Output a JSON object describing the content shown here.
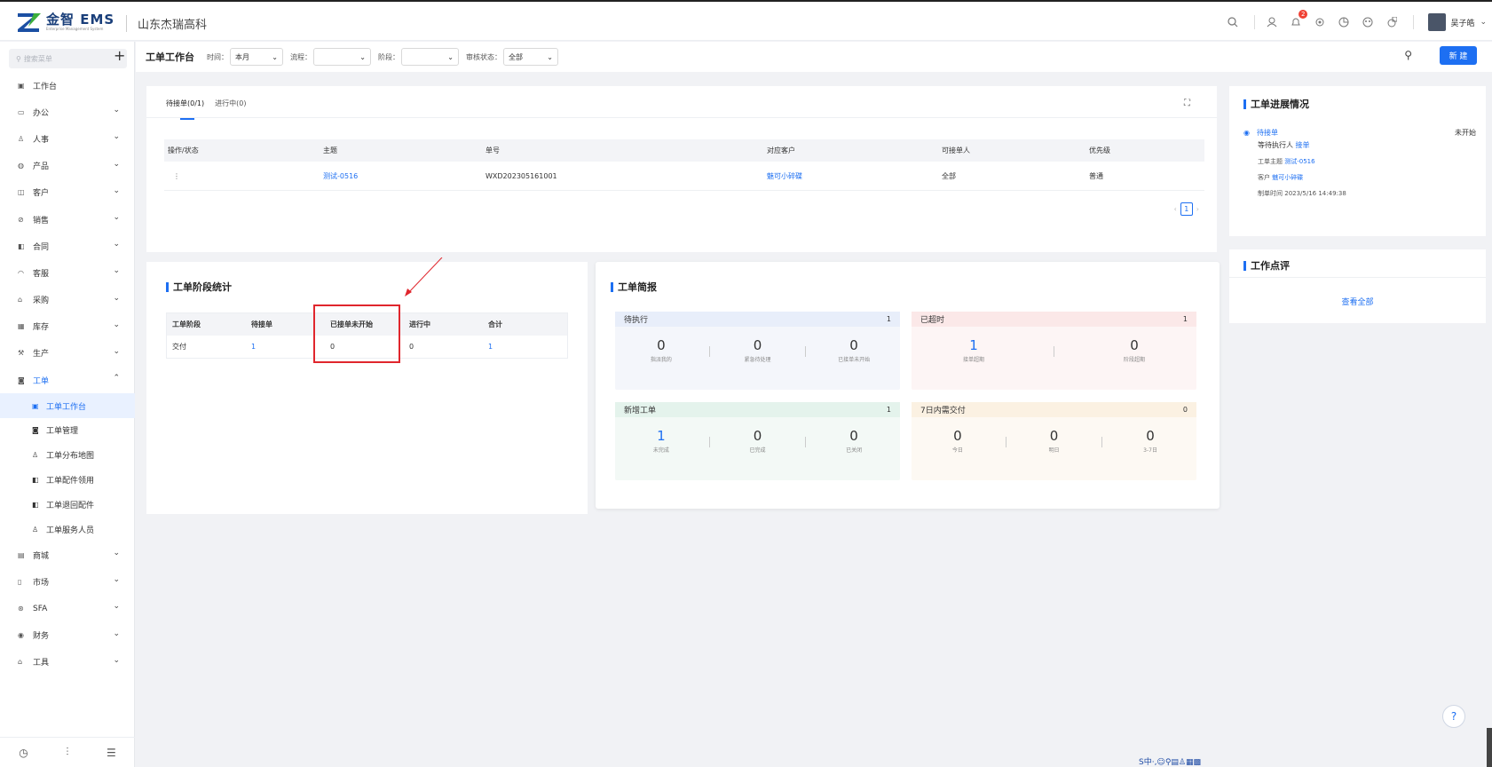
{
  "header": {
    "logo_title": "金智 EMS",
    "logo_sub": "Enterprise Management System",
    "company": "山东杰瑞高科",
    "notif_count": "2",
    "user": "吴子皓"
  },
  "sidebar": {
    "search_placeholder": "搜索菜单",
    "menu": [
      {
        "label": "工作台",
        "icon": "▣"
      },
      {
        "label": "办公",
        "icon": "▭"
      },
      {
        "label": "人事",
        "icon": "♙"
      },
      {
        "label": "产品",
        "icon": "◍"
      },
      {
        "label": "客户",
        "icon": "◫"
      },
      {
        "label": "销售",
        "icon": "⊘"
      },
      {
        "label": "合同",
        "icon": "◧"
      },
      {
        "label": "客服",
        "icon": "◠"
      },
      {
        "label": "采购",
        "icon": "⌂"
      },
      {
        "label": "库存",
        "icon": "▦"
      },
      {
        "label": "生产",
        "icon": "⚒"
      },
      {
        "label": "工单",
        "icon": "◙"
      }
    ],
    "submenu": [
      {
        "label": "工单工作台",
        "icon": "▣"
      },
      {
        "label": "工单管理",
        "icon": "◙"
      },
      {
        "label": "工单分布地图",
        "icon": "♙"
      },
      {
        "label": "工单配件领用",
        "icon": "◧"
      },
      {
        "label": "工单退回配件",
        "icon": "◧"
      },
      {
        "label": "工单服务人员",
        "icon": "♙"
      }
    ],
    "menu2": [
      {
        "label": "商城",
        "icon": "▤"
      },
      {
        "label": "市场",
        "icon": "▯"
      },
      {
        "label": "SFA",
        "icon": "⊛"
      },
      {
        "label": "财务",
        "icon": "◉"
      },
      {
        "label": "工具",
        "icon": "⌂"
      }
    ]
  },
  "filter": {
    "title": "工单工作台",
    "time_label": "时间：",
    "time_value": "本月",
    "process_label": "流程：",
    "process_value": "",
    "stage_label": "阶段：",
    "stage_value": "",
    "audit_label": "审核状态：",
    "audit_value": "全部",
    "new_button": "新 建"
  },
  "orders": {
    "tabs": [
      "待接单(0/1)",
      "进行中(0)"
    ],
    "columns": [
      "操作/状态",
      "主题",
      "单号",
      "对应客户",
      "可接单人",
      "优先级"
    ],
    "rows": [
      {
        "action": "⋮",
        "subject": "测试-0516",
        "number": "WXD202305161001",
        "customer": "魅可小碎碟",
        "assignee": "全部",
        "priority": "普通"
      }
    ],
    "page": "1"
  },
  "stage_stats": {
    "title": "工单阶段统计",
    "columns": [
      "工单阶段",
      "待接单",
      "已接单未开始",
      "进行中",
      "合计"
    ],
    "row": [
      "交付",
      "1",
      "0",
      "0",
      "1"
    ]
  },
  "brief": {
    "title": "工单简报",
    "cards": [
      {
        "title": "待执行",
        "count": "1",
        "bg": "#f4f6fb",
        "hbg": "#e8eefa",
        "items": [
          {
            "v": "0",
            "l": "指派我的"
          },
          {
            "v": "0",
            "l": "紧急待处理"
          },
          {
            "v": "0",
            "l": "已接单未开始"
          }
        ]
      },
      {
        "title": "已超时",
        "count": "1",
        "bg": "#fdf5f5",
        "hbg": "#fbe8e8",
        "items": [
          {
            "v": "1",
            "l": "接单超期"
          },
          {
            "v": "0",
            "l": "阶段超期"
          }
        ]
      },
      {
        "title": "新增工单",
        "count": "1",
        "bg": "#f3f9f6",
        "hbg": "#e4f3ec",
        "items": [
          {
            "v": "1",
            "l": "未完成"
          },
          {
            "v": "0",
            "l": "已完成"
          },
          {
            "v": "0",
            "l": "已关闭"
          }
        ]
      },
      {
        "title": "7日内需交付",
        "count": "0",
        "bg": "#fdf9f3",
        "hbg": "#fbf1e2",
        "items": [
          {
            "v": "0",
            "l": "今日"
          },
          {
            "v": "0",
            "l": "明日"
          },
          {
            "v": "0",
            "l": "3-7日"
          }
        ]
      }
    ]
  },
  "progress": {
    "title": "工单进展情况",
    "item_title": "待接单",
    "status": "未开始",
    "waiting_label": "等待执行人",
    "waiting_value": "接单",
    "subject_label": "工单主题",
    "subject_value": "测试-0516",
    "customer_label": "客户",
    "customer_value": "魅可小碎碟",
    "created_label": "制单时间",
    "created_value": "2023/5/16 14:49:38"
  },
  "review": {
    "title": "工作点评",
    "link": "查看全部"
  },
  "ime": "S中·,☺⚲▤♙▦▩",
  "help": "?"
}
